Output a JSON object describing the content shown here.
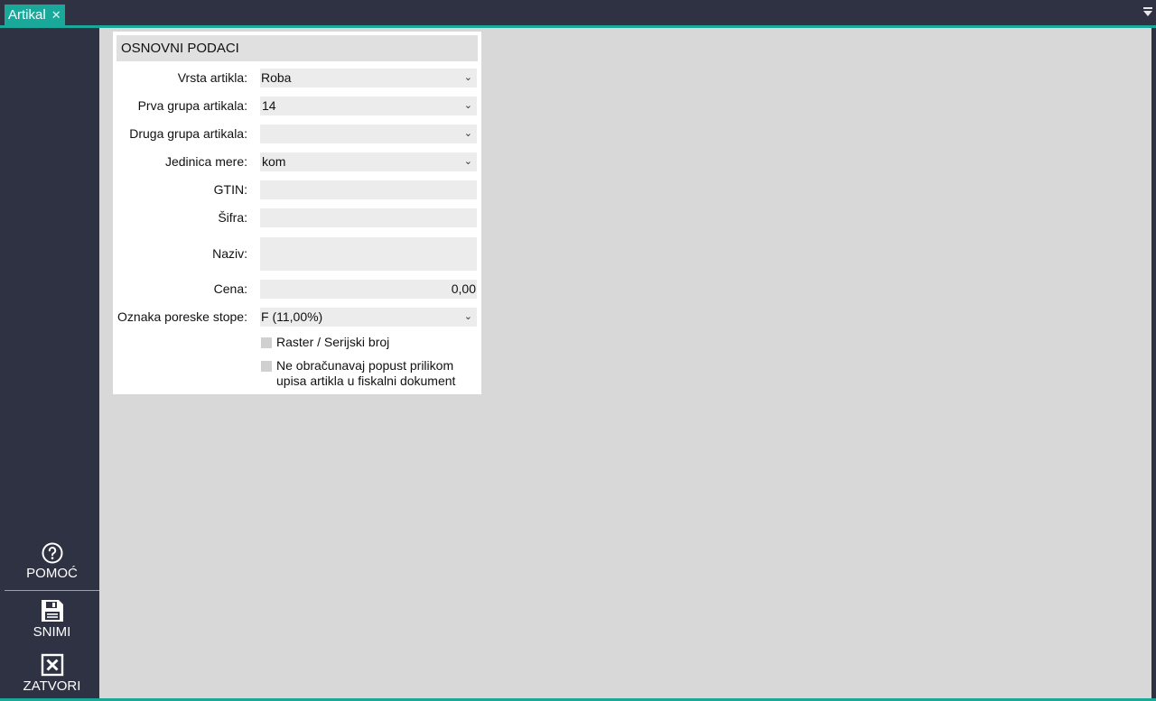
{
  "tab": {
    "title": "Artikal",
    "close_glyph": "✕"
  },
  "sidebar": {
    "help_label": "POMOĆ",
    "save_label": "SNIMI",
    "close_label": "ZATVORI"
  },
  "panel": {
    "title": "OSNOVNI PODACI",
    "fields": {
      "vrsta_label": "Vrsta artikla:",
      "vrsta_value": "Roba",
      "prva_label": "Prva grupa artikala:",
      "prva_value": "14",
      "druga_label": "Druga grupa artikala:",
      "druga_value": "",
      "jedinica_label": "Jedinica mere:",
      "jedinica_value": "kom",
      "gtin_label": "GTIN:",
      "gtin_value": "",
      "sifra_label": "Šifra:",
      "sifra_value": "",
      "naziv_label": "Naziv:",
      "naziv_value": "",
      "cena_label": "Cena:",
      "cena_value": "0,00",
      "porez_label": "Oznaka poreske stope:",
      "porez_value": "F (11,00%)"
    },
    "checkboxes": {
      "raster_label": "Raster / Serijski broj",
      "popust_label": "Ne obračunavaj popust prilikom upisa artikla u fiskalni dokument"
    }
  },
  "colors": {
    "accent": "#19a89a",
    "sidebar_bg": "#2e3243",
    "content_bg": "#d8d8d8",
    "field_bg": "#ececec"
  },
  "icons": [
    "close-icon",
    "menu-dropdown-icon",
    "help-icon",
    "save-icon",
    "close-window-icon",
    "chevron-down-icon"
  ]
}
